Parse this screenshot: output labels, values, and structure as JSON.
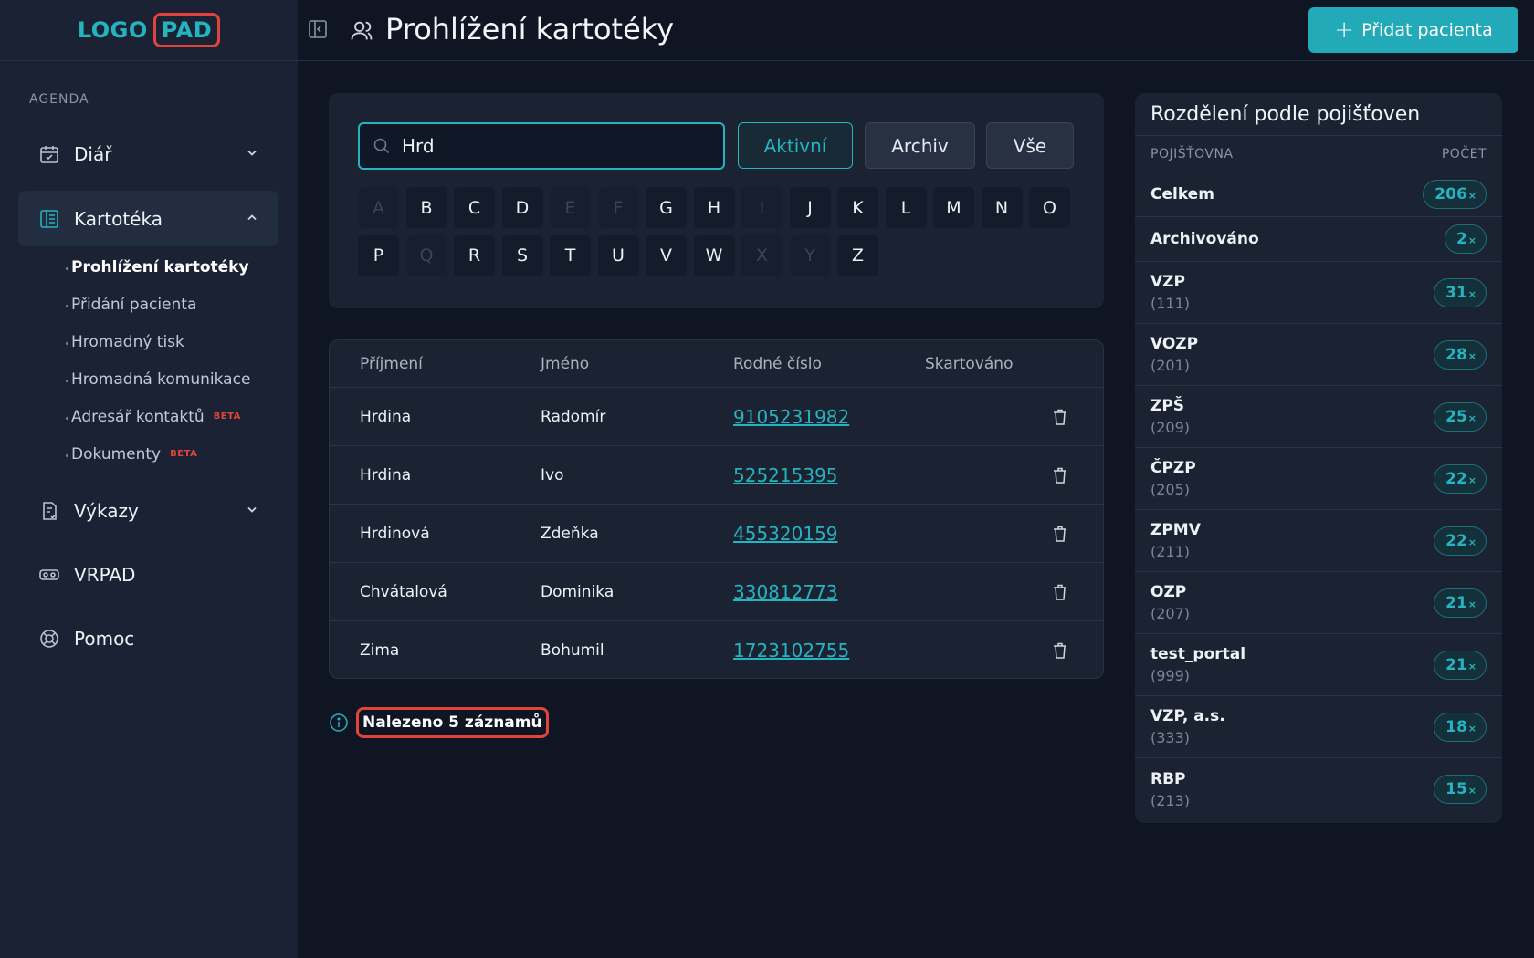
{
  "logo": {
    "part1": "LOGO",
    "part2": "PAD"
  },
  "sidebar": {
    "section_label": "AGENDA",
    "items": [
      {
        "label": "Diář"
      },
      {
        "label": "Kartotéka"
      },
      {
        "label": "Výkazy"
      },
      {
        "label": "VRPAD"
      },
      {
        "label": "Pomoc"
      }
    ],
    "sub_items": [
      {
        "label": "Prohlížení kartotéky"
      },
      {
        "label": "Přidání pacienta"
      },
      {
        "label": "Hromadný tisk"
      },
      {
        "label": "Hromadná komunikace"
      },
      {
        "label": "Adresář kontaktů",
        "badge": "BETA"
      },
      {
        "label": "Dokumenty",
        "badge": "BETA"
      }
    ]
  },
  "header": {
    "title": "Prohlížení kartotéky",
    "add_button": "Přidat pacienta"
  },
  "search": {
    "value": "Hrd",
    "filters": [
      "Aktivní",
      "Archiv",
      "Vše"
    ],
    "letters_row1": [
      "A",
      "B",
      "C",
      "D",
      "E",
      "F",
      "G",
      "H",
      "I",
      "J",
      "K",
      "L",
      "M",
      "N",
      "O"
    ],
    "letters_row2": [
      "P",
      "Q",
      "R",
      "S",
      "T",
      "U",
      "V",
      "W",
      "X",
      "Y",
      "Z"
    ],
    "disabled_letters": [
      "A",
      "E",
      "F",
      "I",
      "Q",
      "X",
      "Y"
    ]
  },
  "table": {
    "columns": [
      "Příjmení",
      "Jméno",
      "Rodné číslo",
      "Skartováno"
    ],
    "rows": [
      {
        "surname": "Hrdina",
        "name": "Radomír",
        "rc": "9105231982"
      },
      {
        "surname": "Hrdina",
        "name": "Ivo",
        "rc": "525215395"
      },
      {
        "surname": "Hrdinová",
        "name": "Zdeňka",
        "rc": "455320159"
      },
      {
        "surname": "Chvátalová",
        "name": "Dominika",
        "rc": "330812773"
      },
      {
        "surname": "Zima",
        "name": "Bohumil",
        "rc": "1723102755"
      }
    ]
  },
  "found_text": "Nalezeno 5 záznamů",
  "insurance": {
    "title": "Rozdělení podle pojišťoven",
    "col_name": "POJIŠŤOVNA",
    "col_count": "POČET",
    "rows": [
      {
        "name": "Celkem",
        "code": "",
        "count": "206"
      },
      {
        "name": "Archivováno",
        "code": "",
        "count": "2"
      },
      {
        "name": "VZP",
        "code": "(111)",
        "count": "31"
      },
      {
        "name": "VOZP",
        "code": "(201)",
        "count": "28"
      },
      {
        "name": "ZPŠ",
        "code": "(209)",
        "count": "25"
      },
      {
        "name": "ČPZP",
        "code": "(205)",
        "count": "22"
      },
      {
        "name": "ZPMV",
        "code": "(211)",
        "count": "22"
      },
      {
        "name": "OZP",
        "code": "(207)",
        "count": "21"
      },
      {
        "name": "test_portal",
        "code": "(999)",
        "count": "21"
      },
      {
        "name": "VZP, a.s.",
        "code": "(333)",
        "count": "18"
      },
      {
        "name": "RBP",
        "code": "(213)",
        "count": "15"
      }
    ],
    "count_suffix": "×"
  },
  "colors": {
    "accent": "#25b3c0",
    "bg": "#0f1523",
    "panel": "#1b2333",
    "beta": "#e0443c"
  }
}
